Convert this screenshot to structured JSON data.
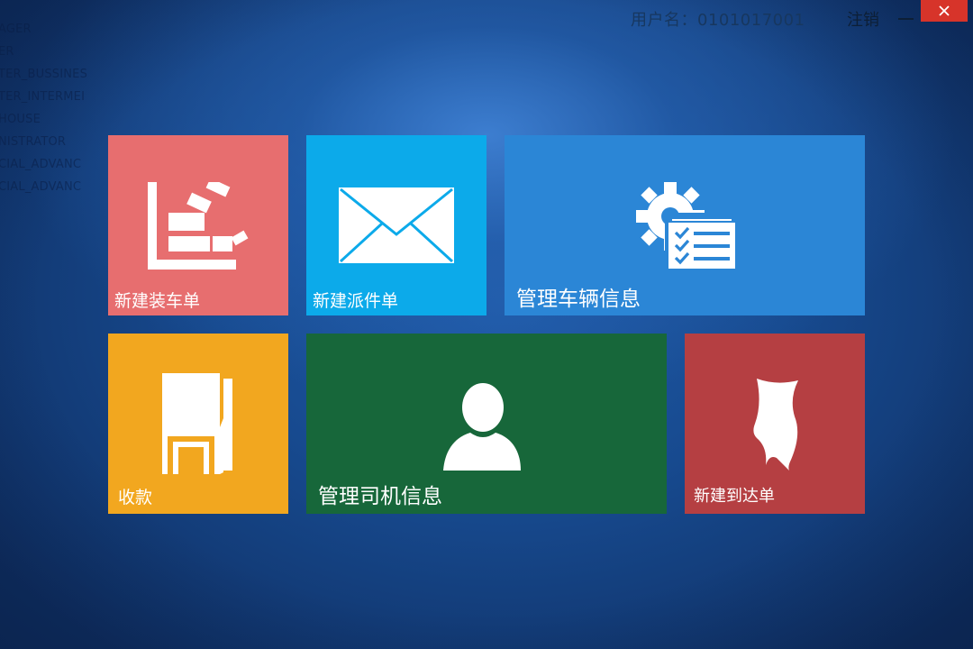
{
  "background_partial_text": [
    "AGER",
    "ER",
    "TER_BUSSINES",
    "TER_INTERMEI",
    "HOUSE",
    "NISTRATOR",
    "CIAL_ADVANC",
    "CIAL_ADVANC"
  ],
  "header": {
    "user_label": "用户名：0101017001",
    "logout_label": "注销",
    "minimize_symbol": "—",
    "close_icon": "close-icon"
  },
  "tiles": [
    {
      "id": "new-loading-order",
      "label": "新建装车单",
      "color": "#e76e6f",
      "icon": "loading-bricks-icon"
    },
    {
      "id": "new-dispatch-order",
      "label": "新建派件单",
      "color": "#0caaea",
      "icon": "envelope-icon"
    },
    {
      "id": "manage-vehicle-info",
      "label": "管理车辆信息",
      "color": "#2b86d6",
      "icon": "gear-checklist-icon"
    },
    {
      "id": "payment",
      "label": "收款",
      "color": "#f2a71f",
      "icon": "warehouse-door-icon"
    },
    {
      "id": "manage-driver-info",
      "label": "管理司机信息",
      "color": "#17673a",
      "icon": "user-icon"
    },
    {
      "id": "new-arrival-order",
      "label": "新建到达单",
      "color": "#b53f42",
      "icon": "ribbon-banner-icon"
    }
  ]
}
